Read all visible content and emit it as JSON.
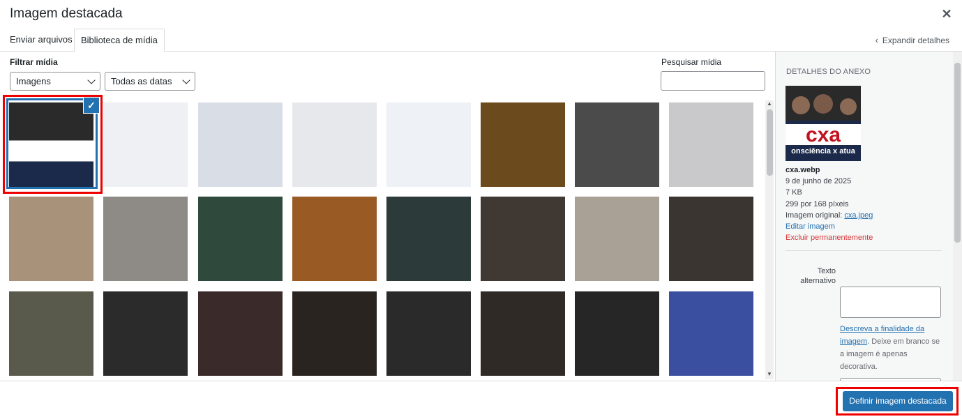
{
  "title": "Imagem destacada",
  "tabs": [
    {
      "label": "Enviar arquivos"
    },
    {
      "label": "Biblioteca de mídia"
    }
  ],
  "expand_details": "Expandir detalhes",
  "filter": {
    "label": "Filtrar mídia",
    "type_value": "Imagens",
    "date_value": "Todas as datas"
  },
  "search": {
    "label": "Pesquisar mídia",
    "placeholder": ""
  },
  "grid_items": [
    {
      "color": "#1b2a4a",
      "selected": true
    },
    {
      "color": "#eef0f3"
    },
    {
      "color": "#d8dde6"
    },
    {
      "color": "#e6e8eb"
    },
    {
      "color": "#eef1f5"
    },
    {
      "color": "#6b4a1e"
    },
    {
      "color": "#4b4b4b"
    },
    {
      "color": "#c9c9cb"
    },
    {
      "color": "#a8937a"
    },
    {
      "color": "#8e8b86"
    },
    {
      "color": "#2f4a3c"
    },
    {
      "color": "#9a5a24"
    },
    {
      "color": "#2c3b3a"
    },
    {
      "color": "#403833"
    },
    {
      "color": "#a9a096"
    },
    {
      "color": "#3a3530"
    },
    {
      "color": "#5a5a4c"
    },
    {
      "color": "#2b2b2b"
    },
    {
      "color": "#3a2a2a"
    },
    {
      "color": "#2a2420"
    },
    {
      "color": "#2a2a2a"
    },
    {
      "color": "#2f2a26"
    },
    {
      "color": "#262626"
    },
    {
      "color": "#3a4fa0"
    }
  ],
  "thumb_selected_text": {
    "logo": "cxa",
    "tagline": "onsciência x atua"
  },
  "details": {
    "heading": "DETALHES DO ANEXO",
    "filename": "cxa.webp",
    "date": "9 de junho de 2025",
    "size": "7 KB",
    "dimensions": "299 por 168 píxeis",
    "original_prefix": "Imagem original: ",
    "original_link": "cxa.jpeg",
    "edit_link": "Editar imagem",
    "delete_link": "Excluir permanentemente",
    "alt_label": "Texto alternativo",
    "alt_value": "",
    "alt_help_link": "Descreva a finalidade da imagem",
    "alt_help_rest": ". Deixe em branco se a imagem é apenas decorativa."
  },
  "primary_button": "Definir imagem destacada",
  "colors": {
    "accent": "#2271b1",
    "highlight": "#ee0000",
    "danger": "#d63638"
  }
}
